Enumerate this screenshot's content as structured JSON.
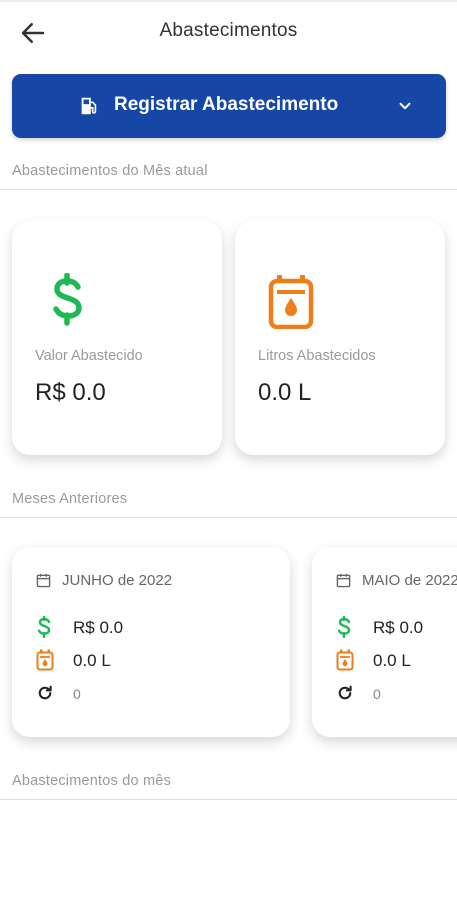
{
  "app_title": "Abastecimentos",
  "register_button": {
    "label": "Registrar Abastecimento",
    "icon": "fuel-pump-icon"
  },
  "sections": {
    "current_month": "Abastecimentos do Mês atual",
    "previous_months": "Meses Anteriores",
    "month_refuels": "Abastecimentos do mês"
  },
  "summary": {
    "value": {
      "caption": "Valor Abastecido",
      "amount": "R$ 0.0",
      "icon": "dollar-icon"
    },
    "liters": {
      "caption": "Litros Abastecidos",
      "amount": "0.0 L",
      "icon": "fuel-can-icon"
    }
  },
  "months": [
    {
      "name": "JUNHO de 2022",
      "value": "R$ 0.0",
      "liters": "0.0 L",
      "count": "0"
    },
    {
      "name": "MAIO de 2022",
      "value": "R$ 0.0",
      "liters": "0.0 L",
      "count": "0"
    }
  ],
  "colors": {
    "primary": "#1747a6",
    "green": "#1db954",
    "orange": "#ef7d1a"
  }
}
